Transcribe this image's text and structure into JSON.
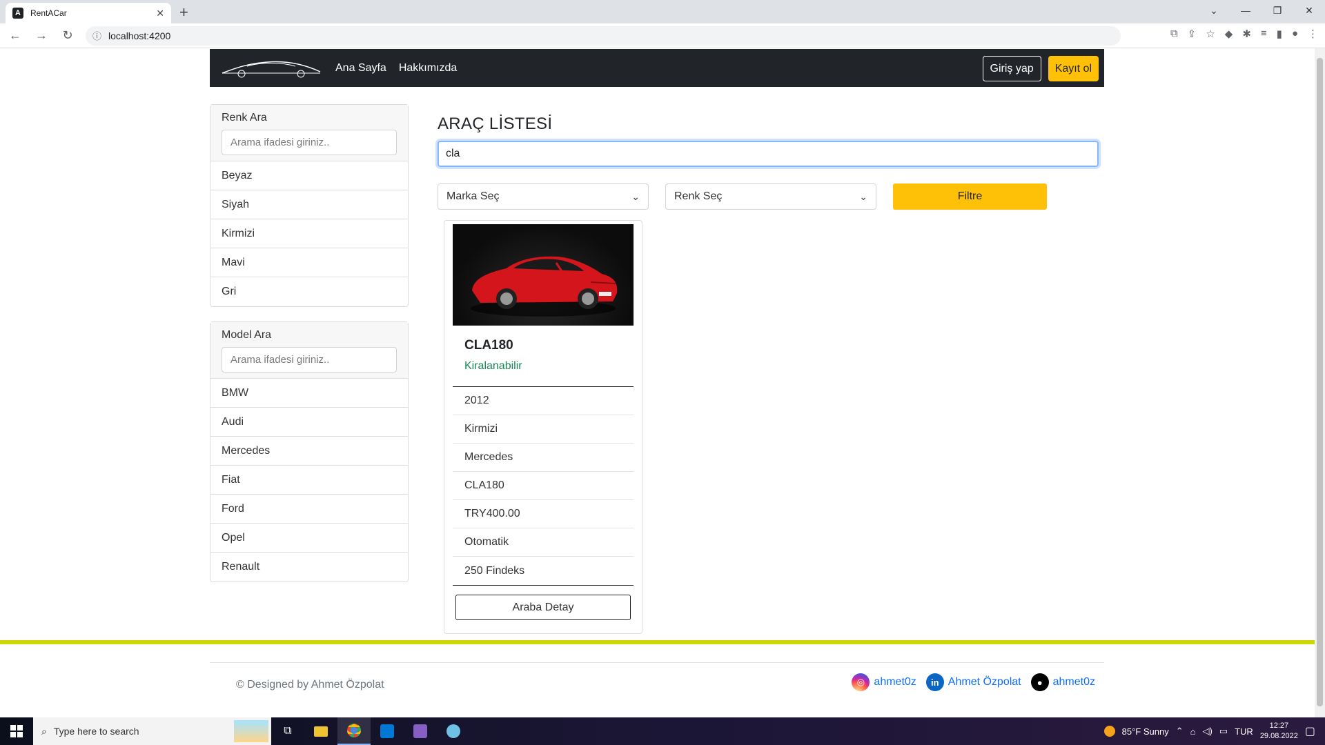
{
  "browser": {
    "tab_title": "RentACar",
    "url": "localhost:4200"
  },
  "navbar": {
    "links": [
      "Ana Sayfa",
      "Hakkımızda"
    ],
    "login_label": "Giriş yap",
    "register_label": "Kayıt ol"
  },
  "sidebar": {
    "color_search": {
      "label": "Renk Ara",
      "placeholder": "Arama ifadesi giriniz..",
      "items": [
        "Beyaz",
        "Siyah",
        "Kirmizi",
        "Mavi",
        "Gri"
      ]
    },
    "model_search": {
      "label": "Model Ara",
      "placeholder": "Arama ifadesi giriniz..",
      "items": [
        "BMW",
        "Audi",
        "Mercedes",
        "Fiat",
        "Ford",
        "Opel",
        "Renault"
      ]
    }
  },
  "main": {
    "title": "ARAÇ LİSTESİ",
    "search_value": "cla",
    "brand_select": "Marka Seç",
    "color_select": "Renk Seç",
    "filter_label": "Filtre",
    "car": {
      "name": "CLA180",
      "status": "Kiralanabilir",
      "details": [
        "2012",
        "Kirmizi",
        "Mercedes",
        "CLA180",
        "TRY400.00",
        "Otomatik",
        "250 Findeks"
      ],
      "detail_button": "Araba Detay"
    }
  },
  "footer": {
    "copyright": "© Designed by Ahmet Özpolat",
    "instagram": "ahmet0z",
    "linkedin": "Ahmet Özpolat",
    "github": "ahmet0z"
  },
  "taskbar": {
    "search_placeholder": "Type here to search",
    "weather": "85°F  Sunny",
    "language": "TUR",
    "time": "12:27",
    "date": "29.08.2022"
  },
  "colors": {
    "accent_yellow": "#ffc107",
    "navbar_bg": "#212529",
    "available_green": "#198754",
    "footer_bar": "#ccd600"
  }
}
